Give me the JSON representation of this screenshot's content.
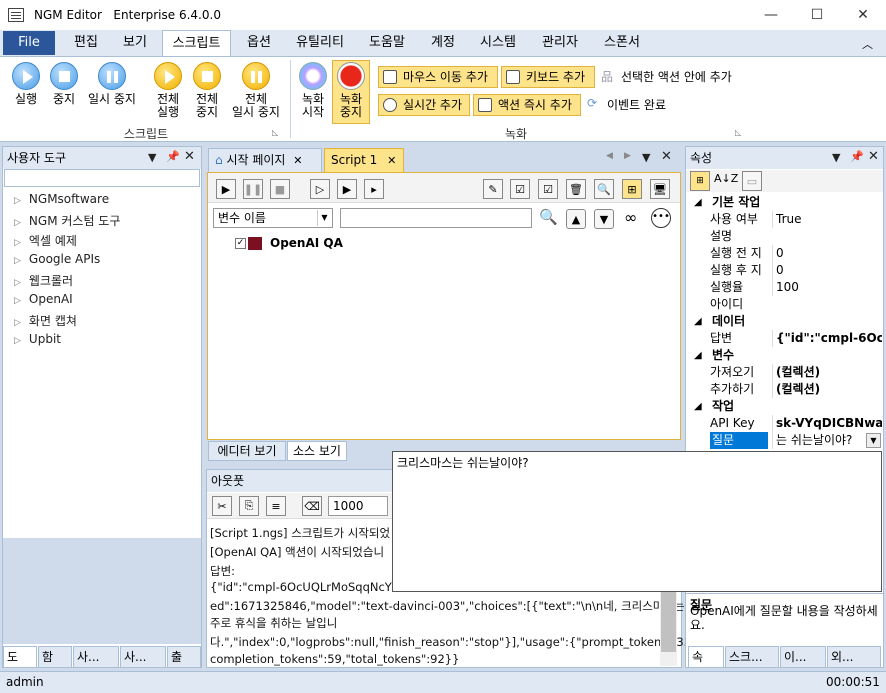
{
  "app": {
    "name": "NGM Editor",
    "edition": "Enterprise 6.4.0.0",
    "controls": {
      "minimize": "—",
      "maximize": "☐",
      "close": "✕"
    }
  },
  "ribbon_tabs": {
    "file": "File",
    "items": [
      "편집",
      "보기",
      "스크립트",
      "옵션",
      "유틸리티",
      "도움말",
      "계정",
      "시스템",
      "관리자",
      "스폰서"
    ],
    "active": "스크립트"
  },
  "ribbon": {
    "script_group": {
      "label": "스크립트",
      "run": "실행",
      "stop": "중지",
      "pause": "일시 중지",
      "all_run": [
        "전체",
        "실행"
      ],
      "all_stop": [
        "전체",
        "중지"
      ],
      "all_pause": [
        "전체",
        "일시 중지"
      ]
    },
    "record_group": {
      "label": "녹화",
      "start": [
        "녹화",
        "시작"
      ],
      "stop": [
        "녹화",
        "중지"
      ],
      "mouse_move": "마우스 이동 추가",
      "keyboard": "키보드 추가",
      "add_in_action": "선택한 액션 안에 추가",
      "realtime": "실시간 추가",
      "immediate": "액션 즉시 추가",
      "event_done": "이벤트 완료"
    }
  },
  "user_tools": {
    "title": "사용자 도구",
    "items": [
      "NGMsoftware",
      "NGM 커스텀 도구",
      "엑셀 예제",
      "Google APIs",
      "웹크롤러",
      "OpenAI",
      "화면 캡쳐",
      "Upbit"
    ]
  },
  "doc_tabs": {
    "start": "시작 페이지",
    "script": "Script 1"
  },
  "editor": {
    "var_combo": "변수 이름",
    "node": "OpenAI QA",
    "view_tabs": [
      "에디터 보기",
      "소스 보기"
    ]
  },
  "output": {
    "title": "아웃풋",
    "count": "1000",
    "lines": [
      "[Script 1.ngs] 스크립트가 시작되었",
      "[OpenAI QA] 액션이 시작되었습니",
      "답변:",
      "{\"id\":\"cmpl-6OcUQLrMoSqqNcYh",
      "ed\":1671325846,\"model\":\"text-davinci-003\",\"choices\":[{\"text\":\"\\n\\n네, 크리스마스는",
      "주로 휴식을 취하는 날입니",
      "다.\",\"index\":0,\"logprobs\":null,\"finish_reason\":\"stop\"}],\"usage\":{\"prompt_tokens\":33,\"",
      "completion_tokens\":59,\"total_tokens\":92}}"
    ]
  },
  "properties": {
    "title": "속성",
    "rows": [
      {
        "type": "cat",
        "label": "기본 작업"
      },
      {
        "type": "prop",
        "key": "사용 여부",
        "value": "True"
      },
      {
        "type": "prop",
        "key": "설명",
        "value": ""
      },
      {
        "type": "prop",
        "key": "실행 전 지",
        "value": "0"
      },
      {
        "type": "prop",
        "key": "실행 후 지",
        "value": "0"
      },
      {
        "type": "prop",
        "key": "실행율",
        "value": "100"
      },
      {
        "type": "prop",
        "key": "아이디",
        "value": ""
      },
      {
        "type": "cat",
        "label": "데이터"
      },
      {
        "type": "prop",
        "key": "답변",
        "value": "{\"id\":\"cmpl-6OcU"
      },
      {
        "type": "cat",
        "label": "변수"
      },
      {
        "type": "prop",
        "key": "가져오기",
        "value": "(컬렉션)"
      },
      {
        "type": "prop",
        "key": "추가하기",
        "value": "(컬렉션)"
      },
      {
        "type": "cat",
        "label": "작업"
      },
      {
        "type": "prop",
        "key": "API Key",
        "value": "sk-VYqDICBNwa"
      },
      {
        "type": "prop",
        "key": "질문",
        "value": "는 쉬는날이야?"
      }
    ],
    "help_title": "질문",
    "help_text": "OpenAI에게 질문할 내용을 작성하세요."
  },
  "popup_text": "크리스마스는 쉬는날이야?",
  "left_bottom_tabs": [
    "도",
    "함",
    "사...",
    "사...",
    "출"
  ],
  "right_bottom_tabs": [
    "속",
    "스크...",
    "이...",
    "외..."
  ],
  "status": {
    "user": "admin",
    "time": "00:00:51"
  }
}
